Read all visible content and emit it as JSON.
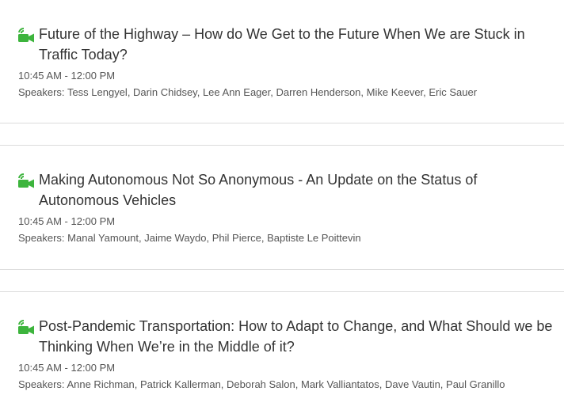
{
  "sessions": [
    {
      "title": "Future of the Highway – How do We Get to the Future When We are Stuck in Traffic Today?",
      "time": "10:45 AM - 12:00 PM",
      "speakers_label": "Speakers:",
      "speakers": "Tess Lengyel, Darin Chidsey, Lee Ann Eager, Darren Henderson, Mike Keever, Eric Sauer",
      "icon": "video-camera-icon"
    },
    {
      "title": "Making Autonomous Not So Anonymous - An Update on the Status of Autonomous Vehicles",
      "time": "10:45 AM - 12:00 PM",
      "speakers_label": "Speakers:",
      "speakers": "Manal Yamount, Jaime Waydo, Phil Pierce, Baptiste Le Poittevin",
      "icon": "video-camera-icon"
    },
    {
      "title": "Post-Pandemic Transportation: How to Adapt to Change, and What Should we be Thinking When We’re in the Middle of it?",
      "time": "10:45 AM - 12:00 PM",
      "speakers_label": "Speakers:",
      "speakers": "Anne Richman, Patrick Kallerman, Deborah Salon, Mark Valliantatos, Dave Vautin, Paul Granillo",
      "icon": "video-camera-icon"
    }
  ],
  "colors": {
    "icon_green": "#3db43d",
    "divider": "#dcdcdc",
    "text": "#333333",
    "meta_text": "#555555"
  }
}
